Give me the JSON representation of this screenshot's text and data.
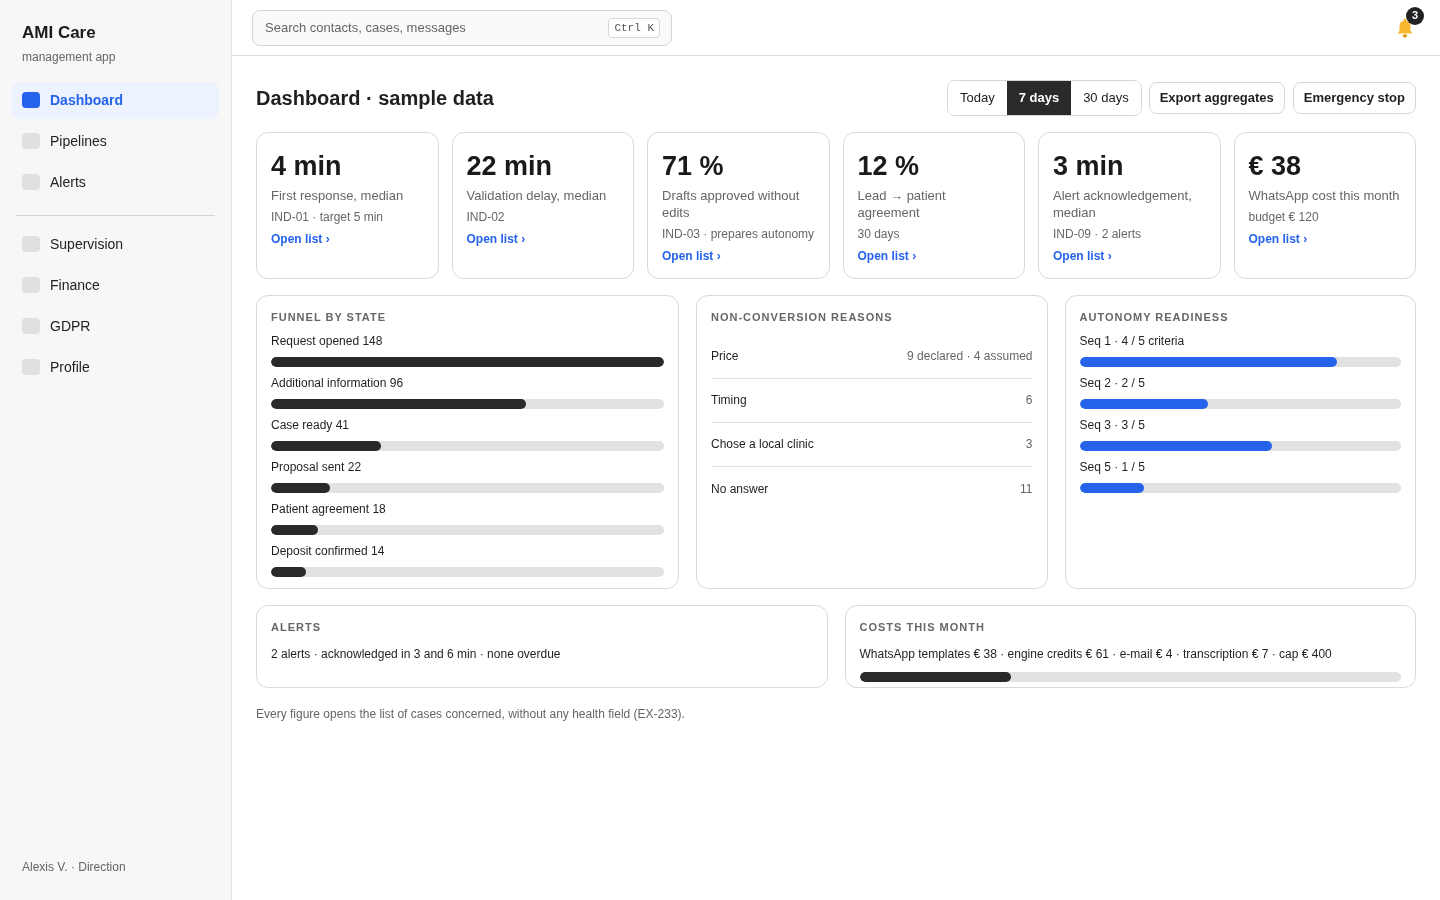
{
  "sidebar": {
    "app_name": "AMI Care",
    "app_subtitle": "management app",
    "nav_groups": [
      [
        {
          "label": "Dashboard",
          "selected": true
        },
        {
          "label": "Pipelines",
          "selected": false
        },
        {
          "label": "Alerts",
          "selected": false
        }
      ],
      [
        {
          "label": "Supervision",
          "selected": false
        },
        {
          "label": "Finance",
          "selected": false
        },
        {
          "label": "GDPR",
          "selected": false
        },
        {
          "label": "Profile",
          "selected": false
        }
      ]
    ],
    "user": "Alexis V. · Direction"
  },
  "topbar": {
    "search": {
      "placeholder": "Search contacts, cases, messages",
      "shortcut": "Ctrl K"
    },
    "notification_count": "3"
  },
  "page": {
    "title": "Dashboard · sample data",
    "ranges": [
      {
        "label": "Today",
        "selected": false
      },
      {
        "label": "7 days",
        "selected": true
      },
      {
        "label": "30 days",
        "selected": false
      }
    ],
    "actions": [
      "Export aggregates",
      "Emergency stop"
    ]
  },
  "kpis": [
    {
      "value": "4 min",
      "label": "First response, median",
      "meta": "IND-01 · target 5 min",
      "link": "Open list ›"
    },
    {
      "value": "22 min",
      "label": "Validation delay, median",
      "meta": "IND-02",
      "link": "Open list ›"
    },
    {
      "value": "71 %",
      "label": "Drafts approved without edits",
      "meta": "IND-03 · prepares autonomy",
      "link": "Open list ›"
    },
    {
      "value": "12 %",
      "label": "Lead → patient agreement",
      "meta": "30 days",
      "link": "Open list ›"
    },
    {
      "value": "3 min",
      "label": "Alert acknowledgement, median",
      "meta": "IND-09 · 2 alerts",
      "link": "Open list ›"
    },
    {
      "value": "€ 38",
      "label": "WhatsApp cost this month",
      "meta": "budget € 120",
      "link": "Open list ›"
    }
  ],
  "funnel": {
    "title": "FUNNEL BY STATE",
    "stages": [
      {
        "label": "Request opened 148",
        "level": 1
      },
      {
        "label": "Additional information 96",
        "level": 0.65
      },
      {
        "label": "Case ready 41",
        "level": 0.28
      },
      {
        "label": "Proposal sent 22",
        "level": 0.15
      },
      {
        "label": "Patient agreement 18",
        "level": 0.12
      },
      {
        "label": "Deposit confirmed 14",
        "level": 0.09
      }
    ]
  },
  "non_conversion": {
    "title": "NON-CONVERSION REASONS",
    "reasons": [
      {
        "label": "Price",
        "count": "9 declared · 4 assumed"
      },
      {
        "label": "Timing",
        "count": "6"
      },
      {
        "label": "Chose a local clinic",
        "count": "3"
      },
      {
        "label": "No answer",
        "count": "11"
      }
    ]
  },
  "autonomy": {
    "title": "AUTONOMY READINESS",
    "sequences": [
      {
        "label": "Seq 1 · 4 / 5 criteria",
        "level": 0.8
      },
      {
        "label": "Seq 2 · 2 / 5",
        "level": 0.4
      },
      {
        "label": "Seq 3 · 3 / 5",
        "level": 0.6
      },
      {
        "label": "Seq 5 · 1 / 5",
        "level": 0.2
      }
    ]
  },
  "alerts": {
    "title": "ALERTS",
    "text": "2 alerts · acknowledged in 3 and 6 min · none overdue"
  },
  "costs": {
    "title": "COSTS THIS MONTH",
    "text": "WhatsApp templates € 38 · engine credits € 61 · e-mail € 4 · transcription € 7 · cap € 400",
    "level": 0.28
  },
  "footnote": "Every figure opens the list of cases concerned, without any health field (EX-233)."
}
